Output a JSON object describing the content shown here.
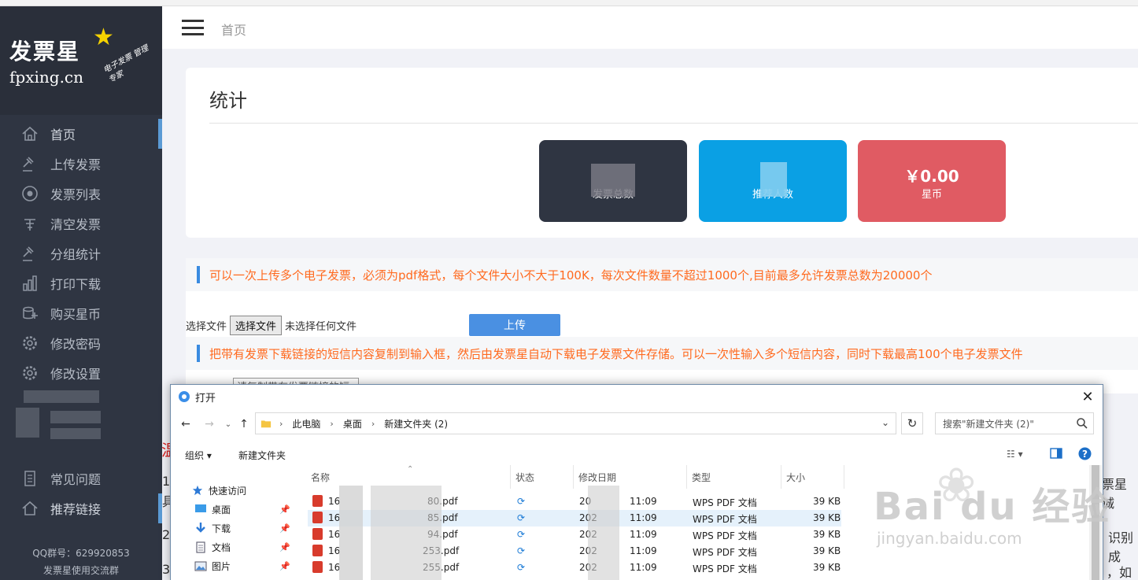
{
  "sidebar": {
    "logo": {
      "brand": "发票星",
      "domain": "fpxing.cn",
      "slogan": "电子发票 管理专家"
    },
    "items": [
      {
        "label": "首页",
        "icon": "home-icon"
      },
      {
        "label": "上传发票",
        "icon": "gavel-icon"
      },
      {
        "label": "发票列表",
        "icon": "target-icon"
      },
      {
        "label": "清空发票",
        "icon": "broom-icon"
      },
      {
        "label": "分组统计",
        "icon": "gavel-icon"
      },
      {
        "label": "打印下载",
        "icon": "bar-chart-icon"
      },
      {
        "label": "购买星币",
        "icon": "coins-icon"
      },
      {
        "label": "修改密码",
        "icon": "gear-icon"
      },
      {
        "label": "修改设置",
        "icon": "gear-icon"
      }
    ],
    "items2": [
      {
        "label": "常见问题",
        "icon": "doc-icon"
      },
      {
        "label": "推荐链接",
        "icon": "home-icon"
      }
    ],
    "qq": "QQ群号：629920853",
    "qq_group": "发票星使用交流群"
  },
  "topbar": {
    "breadcrumb": "首页"
  },
  "stats": {
    "title": "统计",
    "tiles": [
      {
        "value": "",
        "label": "发票总数",
        "color": "#2f3542"
      },
      {
        "value": "",
        "label": "推荐人数",
        "color": "#0aa0e4"
      },
      {
        "value": "￥0.00",
        "label": "星币",
        "color": "#e05b63"
      }
    ]
  },
  "upload": {
    "notice": "可以一次上传多个电子发票，必须为pdf格式，每个文件大小不大于100K，每次文件数量不超过1000个,目前最多允许发票总数为20000个",
    "file_label": "选择文件",
    "file_button": "选择文件",
    "file_status": "未选择任何文件",
    "upload_button": "上传"
  },
  "sms": {
    "notice": "把带有发票下载链接的短信内容复制到输入框，然后由发票星自动下载电子发票文件存储。可以一次性输入多个短信内容，同时下载最高100个电子发票文件",
    "placeholder": "请复制带有发票链接的短"
  },
  "background_text": {
    "red": "温",
    "line1_left": "1",
    "line1_left2": "具",
    "line1_right": "票星诚",
    "line2_left": "2",
    "line2_right": "识别成",
    "line3_left": "3",
    "line3_right": "，如果"
  },
  "watermark": {
    "big": "Bai du 经验",
    "small": "jingyan.baidu.com"
  },
  "dialog": {
    "title": "打开",
    "path": [
      "此电脑",
      "桌面",
      "新建文件夹 (2)"
    ],
    "search_placeholder": "搜索\"新建文件夹 (2)\"",
    "organize": "组织 ▾",
    "new_folder": "新建文件夹",
    "quick_access": [
      {
        "label": "快速访问",
        "icon": "star-icon"
      },
      {
        "label": "桌面",
        "icon": "desktop-icon"
      },
      {
        "label": "下载",
        "icon": "download-icon"
      },
      {
        "label": "文档",
        "icon": "document-icon"
      },
      {
        "label": "图片",
        "icon": "picture-icon"
      }
    ],
    "columns": {
      "name": "名称",
      "status": "状态",
      "modified": "修改日期",
      "type": "类型",
      "size": "大小"
    },
    "files": [
      {
        "name": "16 80.pdf",
        "name_prefix": "16",
        "name_suffix": "80.pdf",
        "date_prefix": "20",
        "time": "11:09",
        "type": "WPS PDF 文档",
        "size": "39 KB"
      },
      {
        "name": "16 85.pdf",
        "name_prefix": "16",
        "name_suffix": "85.pdf",
        "date_prefix": "202",
        "time": "11:09",
        "type": "WPS PDF 文档",
        "size": "39 KB"
      },
      {
        "name": "16 94.pdf",
        "name_prefix": "16",
        "name_suffix": "94.pdf",
        "date_prefix": "202",
        "time": "11:09",
        "type": "WPS PDF 文档",
        "size": "39 KB"
      },
      {
        "name": "16 253.pdf",
        "name_prefix": "16",
        "name_suffix": "253.pdf",
        "date_prefix": "202",
        "time": "11:09",
        "type": "WPS PDF 文档",
        "size": "39 KB"
      },
      {
        "name": "16 255.pdf",
        "name_prefix": "16",
        "name_suffix": "255.pdf",
        "date_prefix": "202",
        "time": "11:09",
        "type": "WPS PDF 文档",
        "size": "39 KB"
      }
    ]
  }
}
